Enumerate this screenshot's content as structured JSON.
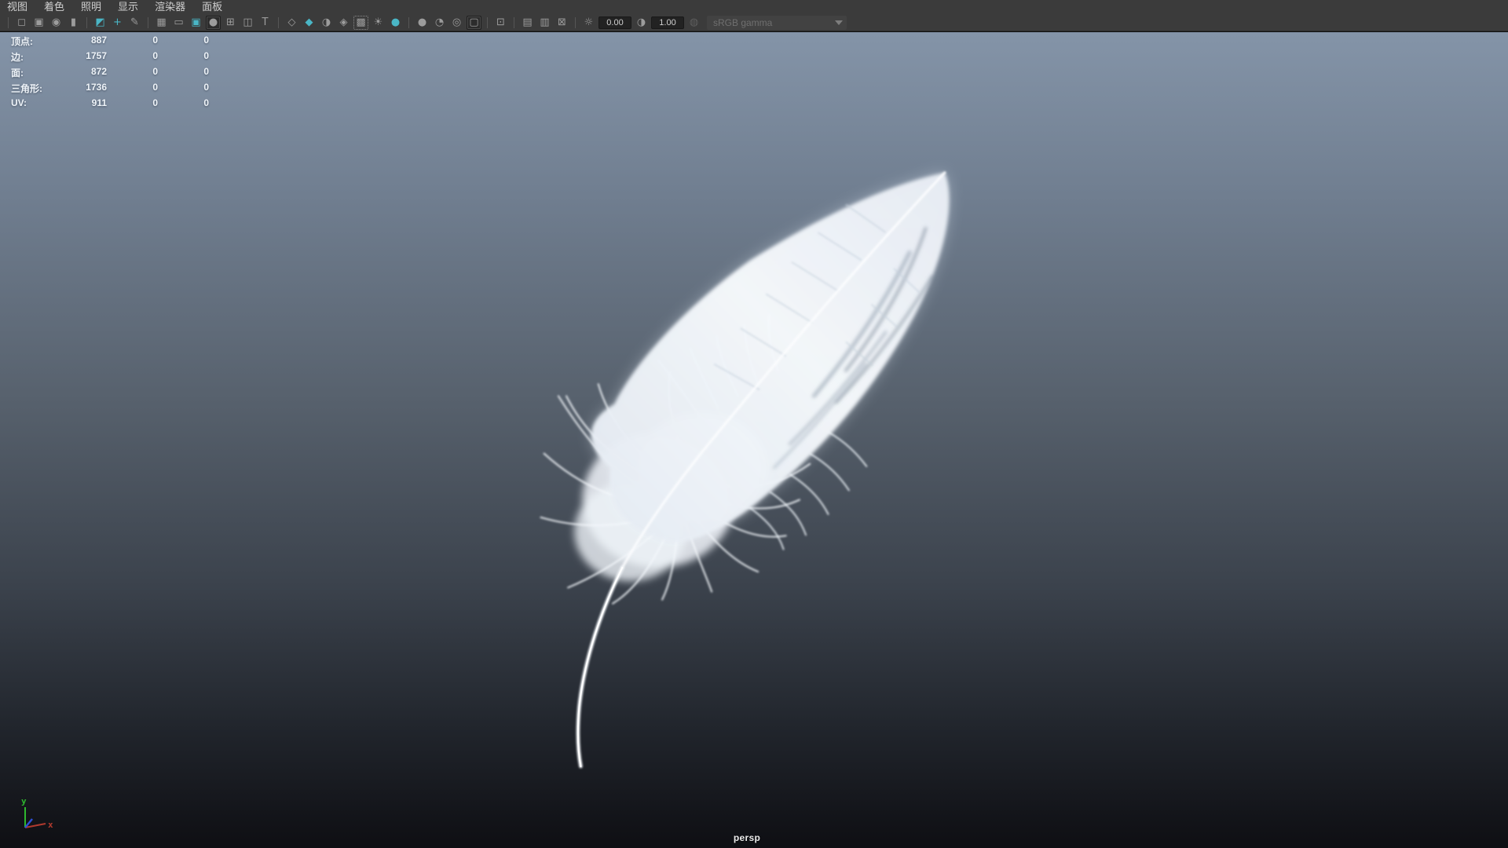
{
  "menu_bar": {
    "items": [
      {
        "label": "视图"
      },
      {
        "label": "着色"
      },
      {
        "label": "照明"
      },
      {
        "label": "显示"
      },
      {
        "label": "渲染器"
      },
      {
        "label": "面板"
      }
    ]
  },
  "toolbar": {
    "icons": [
      {
        "name": "select-camera-icon",
        "glyph": "◻"
      },
      {
        "name": "lock-camera-icon",
        "glyph": "▣"
      },
      {
        "name": "camera-attributes-icon",
        "glyph": "◉"
      },
      {
        "name": "bookmark-icon",
        "glyph": "▮"
      },
      {
        "name": "image-plane-icon",
        "glyph": "◩"
      },
      {
        "name": "pan-zoom-icon",
        "glyph": "+"
      },
      {
        "name": "grease-pencil-icon",
        "glyph": "✎"
      },
      {
        "name": "grid-icon",
        "glyph": "▦"
      },
      {
        "name": "film-gate-icon",
        "glyph": "▭"
      },
      {
        "name": "resolution-gate-icon",
        "glyph": "▣"
      },
      {
        "name": "gate-mask-icon",
        "glyph": "●"
      },
      {
        "name": "field-chart-icon",
        "glyph": "⊞"
      },
      {
        "name": "safe-action-icon",
        "glyph": "◫"
      },
      {
        "name": "safe-title-icon",
        "glyph": "T"
      },
      {
        "name": "wireframe-cube-icon",
        "glyph": "◇"
      },
      {
        "name": "shaded-cube-icon",
        "glyph": "◆"
      },
      {
        "name": "textured-ball-icon",
        "glyph": "◑"
      },
      {
        "name": "wire-on-shaded-icon",
        "glyph": "◈"
      },
      {
        "name": "textured-checker-icon",
        "glyph": "▩"
      },
      {
        "name": "lights-icon",
        "glyph": "☀"
      },
      {
        "name": "shadows-icon",
        "glyph": "●"
      },
      {
        "name": "ssao-icon",
        "glyph": "●"
      },
      {
        "name": "motion-blur-icon",
        "glyph": "◔"
      },
      {
        "name": "anti-aliasing-icon",
        "glyph": "◎"
      },
      {
        "name": "depth-of-field-icon",
        "glyph": "▢"
      },
      {
        "name": "isolate-select-icon",
        "glyph": "⊡"
      },
      {
        "name": "snapshot-copy-icon",
        "glyph": "▤"
      },
      {
        "name": "snapshot-paste-icon",
        "glyph": "▥"
      },
      {
        "name": "image-toggle-icon",
        "glyph": "⊠"
      },
      {
        "name": "exposure-icon",
        "glyph": "☼"
      },
      {
        "name": "contrast-icon",
        "glyph": "◑"
      },
      {
        "name": "gamma-toggle-icon",
        "glyph": "◍"
      }
    ],
    "exposure_value": "0.00",
    "contrast_value": "1.00",
    "gamma_label": "sRGB gamma"
  },
  "hud": {
    "rows": [
      {
        "label": "顶点:",
        "value": "887",
        "col2": "0",
        "col3": "0"
      },
      {
        "label": "边:",
        "value": "1757",
        "col2": "0",
        "col3": "0"
      },
      {
        "label": "面:",
        "value": "872",
        "col2": "0",
        "col3": "0"
      },
      {
        "label": "三角形:",
        "value": "1736",
        "col2": "0",
        "col3": "0"
      },
      {
        "label": "UV:",
        "value": "911",
        "col2": "0",
        "col3": "0"
      }
    ]
  },
  "viewport": {
    "camera_label": "persp",
    "axis_x": "x",
    "axis_y": "y"
  },
  "colors": {
    "header_bg": "#3b3b3b",
    "icon_gray": "#9c9c9c",
    "accent_teal": "#4ab6c6",
    "viewport_top": "#8494a8",
    "viewport_bottom": "#0e0f13",
    "hud_text": "#eef3f8",
    "axis_x_red": "#b03a2e",
    "axis_y_green": "#2eb82e",
    "axis_z_blue": "#2d4fd6"
  }
}
